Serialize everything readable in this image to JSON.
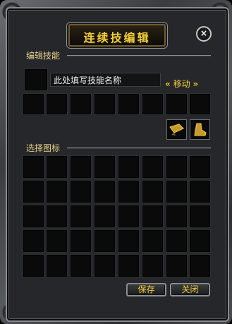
{
  "window": {
    "title": "连续技编辑",
    "close_glyph": "×"
  },
  "edit_section": {
    "label": "编辑技能",
    "name_input_value": "此处填写技能名称",
    "move_label": "移动",
    "move_left_glyph": "«",
    "move_right_glyph": "»"
  },
  "icon_section": {
    "label": "选择图标"
  },
  "footer": {
    "save_label": "保存",
    "close_label": "关闭"
  },
  "colors": {
    "accent_gold": "#f2d03b",
    "panel": "#26272a"
  }
}
